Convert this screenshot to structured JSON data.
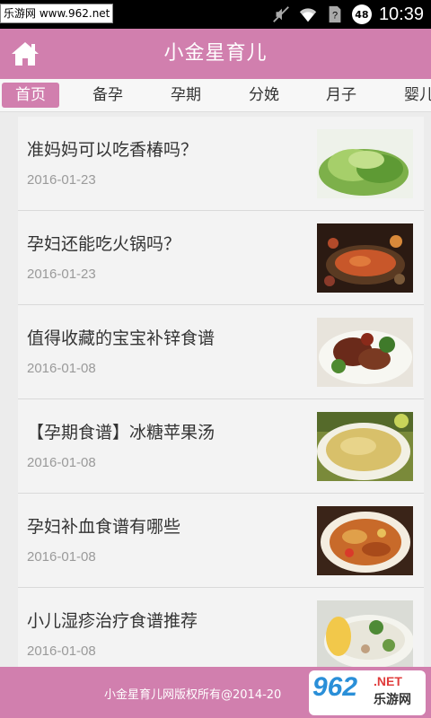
{
  "status_bar": {
    "watermark": "乐游网 www.962.net",
    "battery": "48",
    "time": "10:39"
  },
  "header": {
    "title": "小金星育儿",
    "home_icon": "home-icon"
  },
  "tabs": [
    {
      "label": "首页",
      "active": true
    },
    {
      "label": "备孕",
      "active": false
    },
    {
      "label": "孕期",
      "active": false
    },
    {
      "label": "分娩",
      "active": false
    },
    {
      "label": "月子",
      "active": false
    },
    {
      "label": "婴儿",
      "active": false
    }
  ],
  "articles": [
    {
      "title": "准妈妈可以吃香椿吗？",
      "date": "2016-01-23",
      "thumb": "sprouts"
    },
    {
      "title": "孕妇还能吃火锅吗？",
      "date": "2016-01-23",
      "thumb": "hotpot"
    },
    {
      "title": "值得收藏的宝宝补锌食谱",
      "date": "2016-01-08",
      "thumb": "beef-broccoli"
    },
    {
      "title": "【孕期食谱】冰糖苹果汤",
      "date": "2016-01-08",
      "thumb": "soup-bowl"
    },
    {
      "title": "孕妇补血食谱有哪些",
      "date": "2016-01-08",
      "thumb": "braised-dish"
    },
    {
      "title": "小儿湿疹治疗食谱推荐",
      "date": "2016-01-08",
      "thumb": "corn-soup"
    }
  ],
  "footer": {
    "copyright": "小金星育儿网版权所有@2014-20",
    "logo_main": "962",
    "logo_dot": ".NET",
    "logo_sub": "乐游网"
  },
  "colors": {
    "accent": "#d17fae",
    "status_bar": "#000000",
    "list_bg": "#f3f3f3"
  }
}
